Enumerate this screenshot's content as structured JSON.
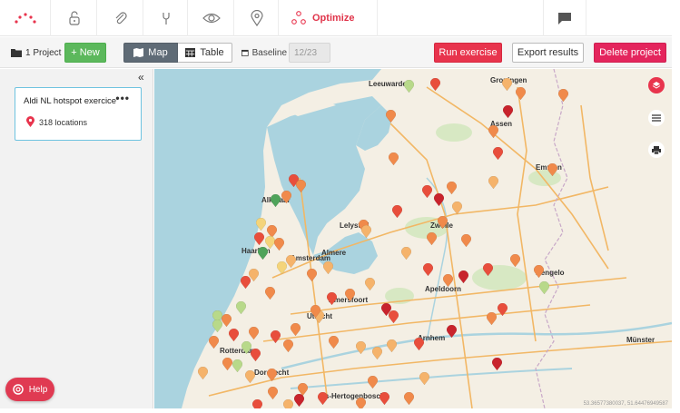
{
  "nav": {
    "optimize_label": "Optimize",
    "icons": [
      "logo-icon",
      "lock-icon",
      "paperclip-icon",
      "tools-icon",
      "eye-icon",
      "map-pin-icon",
      "optimize-icon",
      "chat-icon"
    ]
  },
  "toolbar": {
    "project_count": "1 Project",
    "new_label": "+ New",
    "map_label": "Map",
    "table_label": "Table",
    "baseline_label": "Baseline",
    "baseline_value": "12/23",
    "run_label": "Run exercise",
    "export_label": "Export results",
    "delete_label": "Delete project"
  },
  "sidebar": {
    "collapse": "«",
    "card": {
      "title": "Aldi NL hotspot exercice",
      "menu": "•••",
      "locations": "318 locations"
    },
    "help_label": "Help"
  },
  "map": {
    "places": [
      {
        "name": "Leeuwarden",
        "major": true
      },
      {
        "name": "Groningen",
        "major": true
      },
      {
        "name": "Assen",
        "major": true
      },
      {
        "name": "Emmen",
        "major": true
      },
      {
        "name": "Alkmaar",
        "major": true
      },
      {
        "name": "Lelystad",
        "major": true
      },
      {
        "name": "Zwolle",
        "major": true
      },
      {
        "name": "Haarlem",
        "major": true
      },
      {
        "name": "Amsterdam",
        "major": true
      },
      {
        "name": "Almere",
        "major": true
      },
      {
        "name": "Apeldoorn",
        "major": true
      },
      {
        "name": "Amersfoort",
        "major": true
      },
      {
        "name": "Hengelo",
        "major": true
      },
      {
        "name": "Utrecht",
        "major": true
      },
      {
        "name": "Rotterdam",
        "major": true
      },
      {
        "name": "Arnhem",
        "major": true
      },
      {
        "name": "Dordrecht",
        "major": true
      },
      {
        "name": "'s-Hertogenbosch",
        "major": true
      },
      {
        "name": "Münster",
        "major": true
      }
    ],
    "coords": "53.36577380037, 51.64476949587",
    "colors": {
      "red": "#e84e3c",
      "darkred": "#c8232c",
      "orange": "#f08a4b",
      "lightorange": "#f5b36b",
      "yellow": "#f4d47a",
      "lightgreen": "#b8d98a",
      "green": "#4fa35a"
    }
  }
}
